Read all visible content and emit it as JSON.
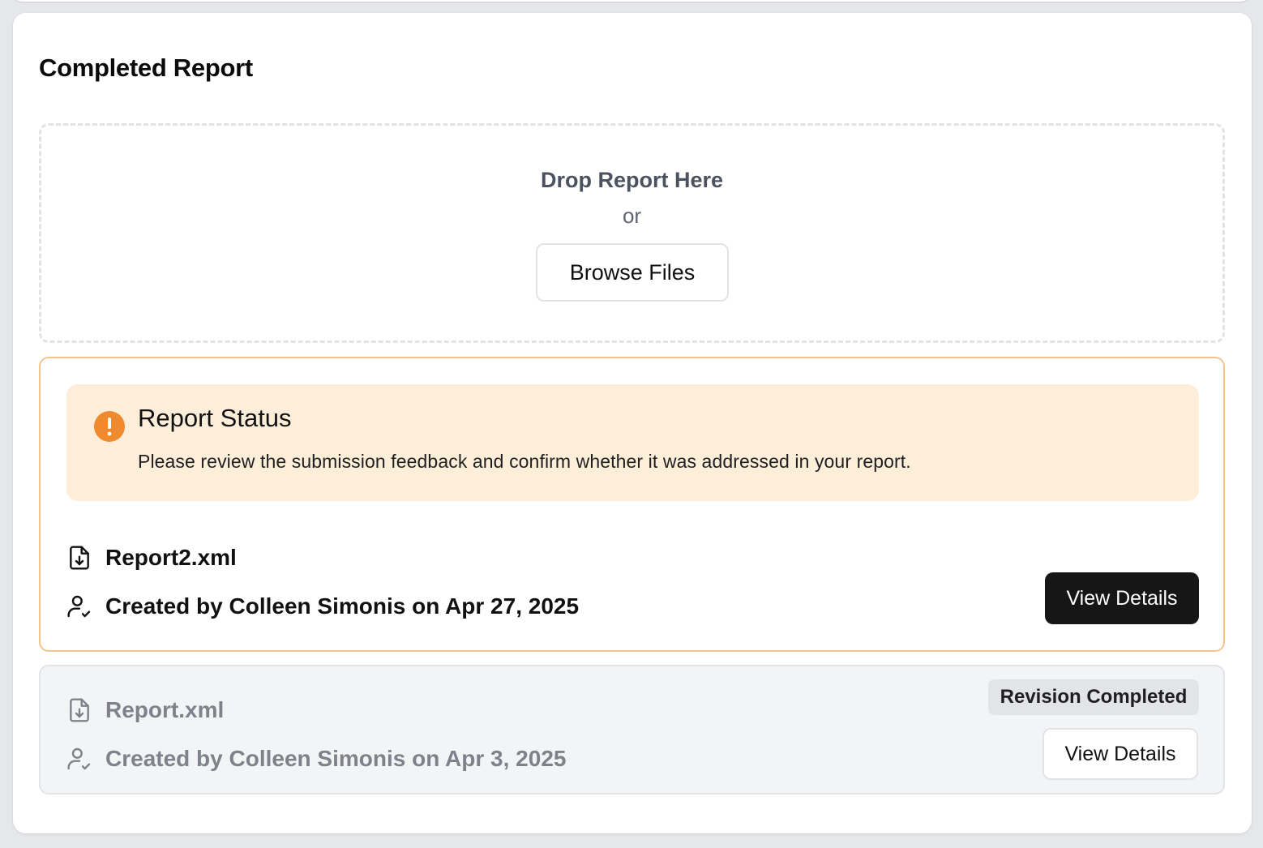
{
  "card": {
    "title": "Completed Report"
  },
  "upload": {
    "title": "Drop Report Here",
    "or_text": "or",
    "browse_label": "Browse Files"
  },
  "status_banner": {
    "icon": "exclamation-circle-icon",
    "title": "Report Status",
    "message": "Please review the submission feedback and confirm whether it was addressed in your report.",
    "color": "#f08a2e"
  },
  "reports": [
    {
      "file_name": "Report2.xml",
      "created_text": "Created by Colleen Simonis on Apr 27, 2025",
      "button_label": "View Details",
      "file_icon": "file-download-icon",
      "user_icon": "user-check-icon"
    },
    {
      "file_name": "Report.xml",
      "created_text": "Created by Colleen Simonis on Apr 3, 2025",
      "badge": "Revision Completed",
      "button_label": "View Details",
      "file_icon": "file-download-icon",
      "user_icon": "user-check-icon"
    }
  ]
}
